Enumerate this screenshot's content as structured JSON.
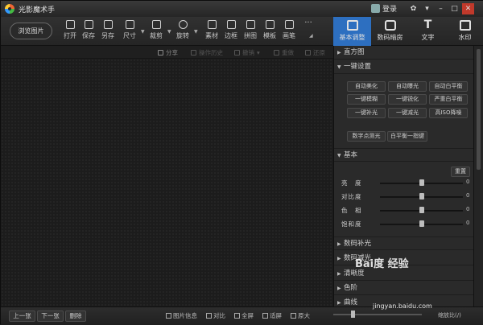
{
  "app": {
    "title": "光影魔术手",
    "login": "登录"
  },
  "toolbar": {
    "browse": "浏览图片",
    "tools": [
      "打开",
      "保存",
      "另存",
      "尺寸",
      "裁剪",
      "旋转",
      "素材",
      "边框",
      "拼图",
      "模板",
      "画笔"
    ],
    "more": "···"
  },
  "panel_tabs": [
    {
      "label": "基本调整",
      "active": true,
      "icon": "adjust-icon"
    },
    {
      "label": "数码暗房",
      "active": false,
      "icon": "camera-icon"
    },
    {
      "label": "文字",
      "active": false,
      "icon": "text-icon"
    },
    {
      "label": "水印",
      "active": false,
      "icon": "watermark-icon"
    }
  ],
  "subbar": {
    "share": "分享",
    "history": "操作历史",
    "undo": "撤销",
    "redo": "重做",
    "restore": "还原"
  },
  "sections": {
    "histogram": "直方图",
    "oneclick": "一键设置",
    "basic": "基本",
    "digital_fill": "数码补光",
    "digital_reduce": "数码减光",
    "sharpness": "清晰度",
    "levels": "色阶",
    "curves": "曲线"
  },
  "oneclick_buttons": [
    "自动美化",
    "自动曝光",
    "自动白平衡",
    "一键模糊",
    "一键锐化",
    "严重白平衡",
    "一键补光",
    "一键减光",
    "高ISO降噪",
    "数字点测光",
    "白平衡一指键"
  ],
  "basic": {
    "reset": "重置",
    "sliders": [
      {
        "label": "亮　度",
        "value": "0",
        "level": 0.5
      },
      {
        "label": "对比度",
        "value": "0",
        "level": 0.5
      },
      {
        "label": "色　相",
        "value": "0",
        "level": 0.5
      },
      {
        "label": "饱和度",
        "value": "0",
        "level": 0.5
      }
    ]
  },
  "bottom": {
    "prev": "上一张",
    "next": "下一张",
    "delete": "删除",
    "info": "图片信息",
    "compare": "对比",
    "fullscreen": "全屏",
    "fit": "适屏",
    "original": "原大",
    "zoom_label": "缩放比(/)"
  },
  "watermark": {
    "brand": "Bai度 经验",
    "site": "jingyan.baidu.com"
  }
}
